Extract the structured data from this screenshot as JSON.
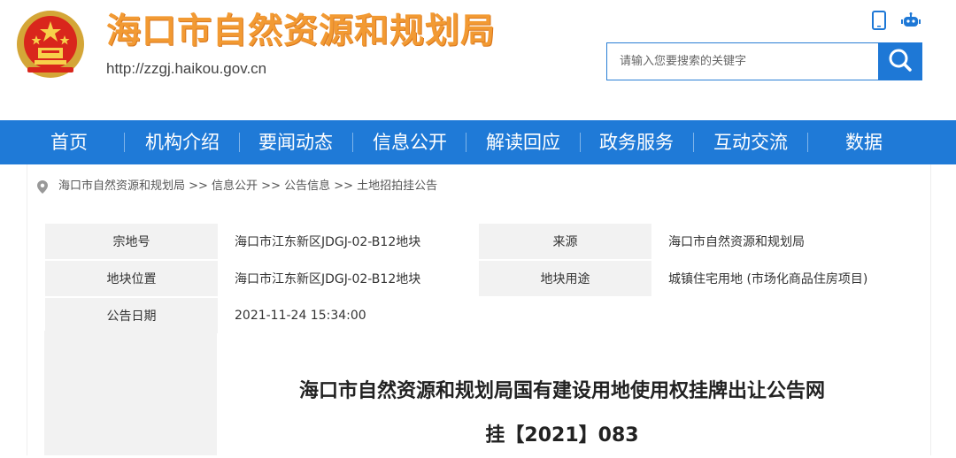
{
  "header": {
    "site_title": "海口市自然资源和规划局",
    "site_url": "http://zzgj.haikou.gov.cn",
    "emblem_icon": "national-emblem-icon",
    "icons": [
      "mobile-phone-icon",
      "robot-icon"
    ],
    "title_color": "#f29a33"
  },
  "search": {
    "placeholder": "请输入您要搜索的关键字",
    "button_icon": "search-icon",
    "color": "#1e78d6"
  },
  "nav": {
    "color": "#1f7ad7",
    "items": [
      "首页",
      "机构介绍",
      "要闻动态",
      "信息公开",
      "解读回应",
      "政务服务",
      "互动交流",
      "数据"
    ]
  },
  "breadcrumb": {
    "icon": "location-pin-icon",
    "text": "海口市自然资源和规划局 >> 信息公开 >> 公告信息 >> 土地招拍挂公告"
  },
  "info": {
    "row1": {
      "k1": "宗地号",
      "v1": "海口市江东新区JDGJ-02-B12地块",
      "k2": "来源",
      "v2": "海口市自然资源和规划局"
    },
    "row2": {
      "k1": "地块位置",
      "v1": "海口市江东新区JDGJ-02-B12地块",
      "k2": "地块用途",
      "v2": "城镇住宅用地 (市场化商品住房项目)"
    },
    "row3": {
      "k1": "公告日期",
      "v1": "2021-11-24 15:34:00"
    }
  },
  "document": {
    "title_line1": "海口市自然资源和规划局国有建设用地使用权挂牌出让公告网",
    "title_line2": "挂【2021】083"
  }
}
